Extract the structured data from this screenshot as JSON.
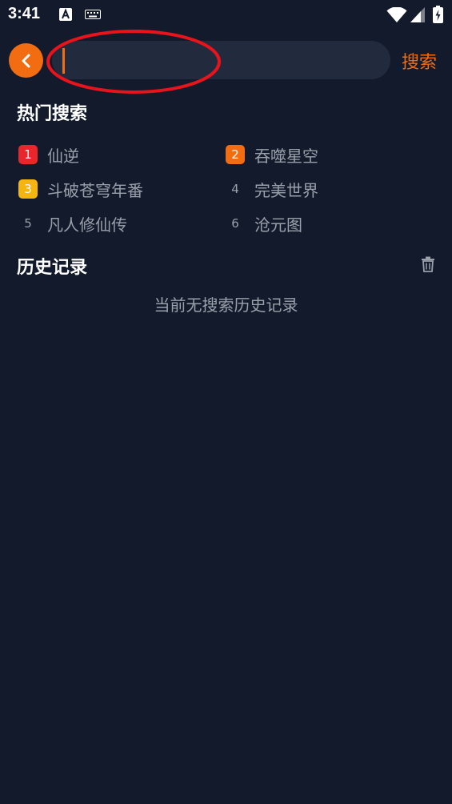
{
  "status_bar": {
    "time": "3:41",
    "icons": [
      "a-badge-icon",
      "keyboard-icon",
      "wifi-icon",
      "signal-icon",
      "battery-charging-icon"
    ]
  },
  "search": {
    "back_icon": "chevron-left-icon",
    "placeholder": "",
    "value": "",
    "button_label": "搜索",
    "accent_color": "#f26c11"
  },
  "hot_search": {
    "title": "热门搜索",
    "items": [
      {
        "rank": "1",
        "label": "仙逆",
        "badge_color": "#e8262c"
      },
      {
        "rank": "2",
        "label": "吞噬星空",
        "badge_color": "#f26c11"
      },
      {
        "rank": "3",
        "label": "斗破苍穹年番",
        "badge_color": "#f5b50f"
      },
      {
        "rank": "4",
        "label": "完美世界",
        "badge_color": ""
      },
      {
        "rank": "5",
        "label": "凡人修仙传",
        "badge_color": ""
      },
      {
        "rank": "6",
        "label": "沧元图",
        "badge_color": ""
      }
    ]
  },
  "history": {
    "title": "历史记录",
    "clear_icon": "trash-icon",
    "empty_text": "当前无搜索历史记录"
  }
}
